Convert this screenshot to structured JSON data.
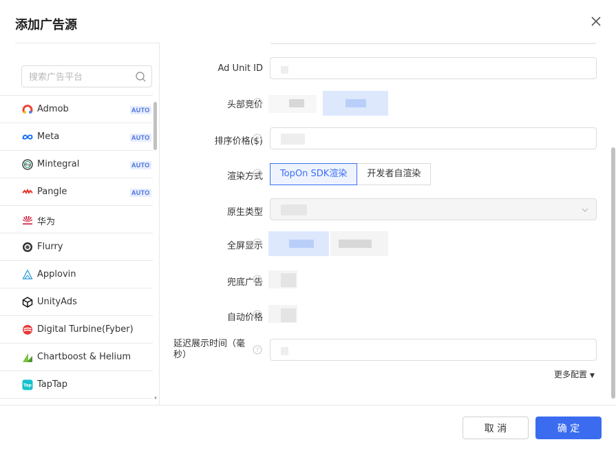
{
  "dialog": {
    "title": "添加广告源"
  },
  "colors": {
    "primary": "#3b6cf0",
    "auto_badge_text": "#4a6ee0",
    "auto_badge_bg": "#e6edfc"
  },
  "search": {
    "placeholder": "搜索广告平台",
    "icon": "search-icon"
  },
  "platforms": [
    {
      "name": "Admob",
      "auto": "AUTO",
      "icon": "admob-icon"
    },
    {
      "name": "Meta",
      "auto": "AUTO",
      "icon": "meta-icon"
    },
    {
      "name": "Mintegral",
      "auto": "AUTO",
      "icon": "mintegral-icon"
    },
    {
      "name": "Pangle",
      "auto": "AUTO",
      "icon": "pangle-icon"
    },
    {
      "name": "华为",
      "auto": "",
      "icon": "huawei-icon"
    },
    {
      "name": "Flurry",
      "auto": "",
      "icon": "flurry-icon"
    },
    {
      "name": "Applovin",
      "auto": "",
      "icon": "applovin-icon"
    },
    {
      "name": "UnityAds",
      "auto": "",
      "icon": "unity-icon"
    },
    {
      "name": "Digital Turbine(Fyber)",
      "auto": "",
      "icon": "digital-turbine-icon"
    },
    {
      "name": "Chartboost & Helium",
      "auto": "",
      "icon": "chartboost-icon"
    },
    {
      "name": "TapTap",
      "auto": "",
      "icon": "taptap-icon"
    }
  ],
  "form": {
    "ad_unit_id_label": "Ad Unit ID",
    "header_bidding_label": "头部竞价",
    "sort_price_label": "排序价格($)",
    "render_mode_label": "渲染方式",
    "render_option_topon": "TopOn SDK渲染",
    "render_option_developer": "开发者自渲染",
    "native_type_label": "原生类型",
    "fullscreen_label": "全屏显示",
    "fallback_label": "兜底广告",
    "auto_price_label": "自动价格",
    "delay_label": "延迟展示时间（毫秒）",
    "more_config": "更多配置"
  },
  "footer": {
    "cancel": "取 消",
    "confirm": "确 定"
  }
}
